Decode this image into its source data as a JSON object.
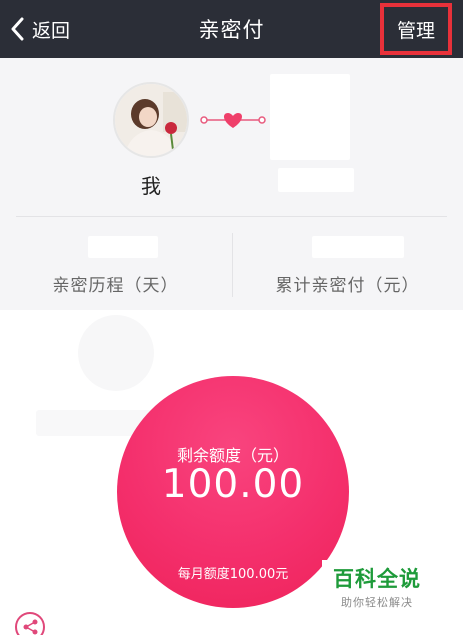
{
  "header": {
    "back_label": "返回",
    "title": "亲密付",
    "manage_label": "管理",
    "bg_color": "#2b2e37",
    "highlight_color": "#e8313a"
  },
  "profile": {
    "me_name": "我",
    "link_icon": "heart-link-icon",
    "stats": [
      {
        "label": "亲密历程（天）"
      },
      {
        "label": "累计亲密付（元）"
      }
    ]
  },
  "quota": {
    "title": "剩余额度（元）",
    "amount": "100.00",
    "monthly": "每月额度100.00元",
    "color": "#f42f6c"
  },
  "watermark": {
    "main": "百科全说",
    "sub": "助你轻松解决",
    "color": "#1e9b3a"
  },
  "share": {
    "icon": "share-icon"
  }
}
